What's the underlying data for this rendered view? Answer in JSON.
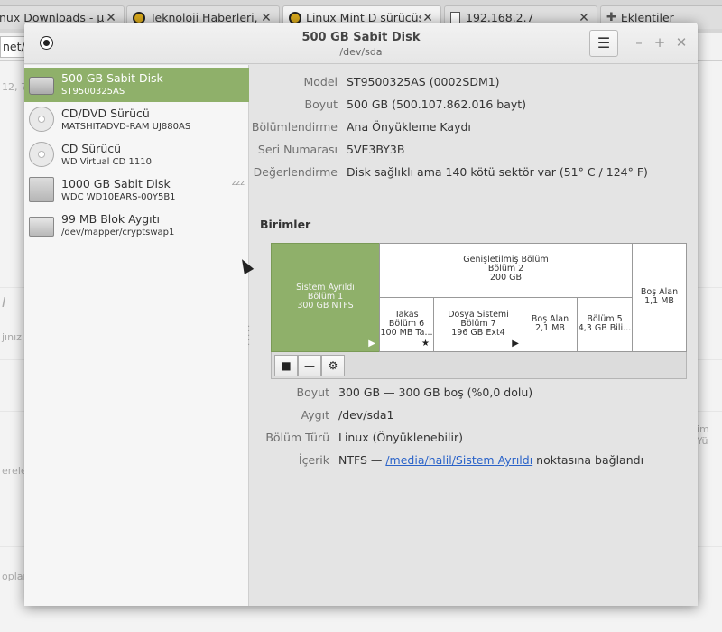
{
  "browser": {
    "tabs": [
      {
        "label": "nux Downloads - µT",
        "icon": "page-icon",
        "close": "✕"
      },
      {
        "label": "Teknoloji Haberleri, İç",
        "icon": "tux-icon",
        "close": "✕"
      },
      {
        "label": "Linux Mint D sürücüsü",
        "icon": "tux-icon",
        "close": "✕"
      },
      {
        "label": "192.168.2.7",
        "icon": "page-icon",
        "close": "✕"
      },
      {
        "label": "Eklentiler",
        "icon": "puzzle-icon",
        "close": ""
      }
    ],
    "address_fragment": "net/t",
    "bg_snippets": [
      "12, 7",
      "I",
      "jınız",
      "erele",
      "oplan",
      "im Yü"
    ]
  },
  "window": {
    "title": "500 GB Sabit Disk",
    "subtitle": "/dev/sda",
    "menu_icon": "☰",
    "minimize": "–",
    "maximize": "+",
    "close": "✕"
  },
  "devices": [
    {
      "name": "500 GB Sabit Disk",
      "detail": "ST9500325AS",
      "icon": "hdd-icon",
      "selected": true
    },
    {
      "name": "CD/DVD Sürücü",
      "detail": "MATSHITADVD-RAM UJ880AS",
      "icon": "cd-icon"
    },
    {
      "name": "CD Sürücü",
      "detail": "WD Virtual CD 1110",
      "icon": "cd-icon"
    },
    {
      "name": "1000 GB Sabit Disk",
      "detail": "WDC WD10EARS-00Y5B1",
      "icon": "usb-icon",
      "badge": "zzz"
    },
    {
      "name": "99 MB Blok Aygıtı",
      "detail": "/dev/mapper/cryptswap1",
      "icon": "block-icon"
    }
  ],
  "disk_info": [
    {
      "label": "Model",
      "value": "ST9500325AS (0002SDM1)"
    },
    {
      "label": "Boyut",
      "value": "500 GB (500.107.862.016 bayt)"
    },
    {
      "label": "Bölümlendirme",
      "value": "Ana Önyükleme Kaydı"
    },
    {
      "label": "Seri Numarası",
      "value": "5VE3BY3B"
    },
    {
      "label": "Değerlendirme",
      "value": "Disk sağlıklı ama 140 kötü sektör var (51° C / 124° F)"
    }
  ],
  "volumes_title": "Birimler",
  "volumes": {
    "sistem": [
      "Sistem Ayrıldı",
      "Bölüm 1",
      "300 GB NTFS"
    ],
    "extended": [
      "Genişletilmiş Bölüm",
      "Bölüm 2",
      "200 GB"
    ],
    "free_top": [
      "Boş Alan",
      "1,1 MB"
    ],
    "takas": [
      "Takas",
      "Bölüm 6",
      "100 MB Ta..."
    ],
    "dosya": [
      "Dosya Sistemi",
      "Bölüm 7",
      "196 GB Ext4"
    ],
    "free_mid": [
      "Boş Alan",
      "2,1 MB"
    ],
    "bolum5": [
      "Bölüm 5",
      "4,3 GB Bili..."
    ],
    "play_mark": "▶",
    "star_mark": "★"
  },
  "volume_toolbar": {
    "stop": "■",
    "remove": "—",
    "settings": "⚙"
  },
  "volume_info": [
    {
      "label": "Boyut",
      "value": "300 GB — 300 GB boş (%0,0 dolu)"
    },
    {
      "label": "Aygıt",
      "value": "/dev/sda1"
    },
    {
      "label": "Bölüm Türü",
      "value": "Linux (Önyüklenebilir)"
    },
    {
      "label": "İçerik",
      "prefix": "NTFS — ",
      "link": "/media/halil/Sistem Ayrıldı",
      "suffix": " noktasına bağlandı"
    }
  ]
}
